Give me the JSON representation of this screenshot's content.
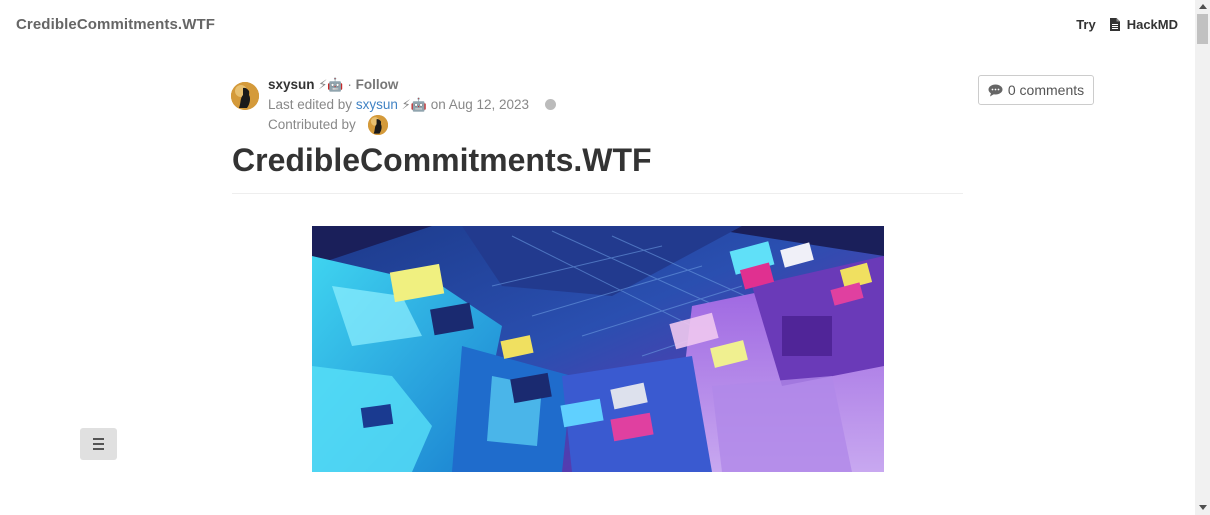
{
  "navbar": {
    "brand": "CredibleCommitments.WTF",
    "try_label": "Try",
    "hackmd_label": "HackMD"
  },
  "author": {
    "name": "sxysun",
    "badges": "⚡🤖",
    "separator": "·",
    "follow_label": "Follow"
  },
  "edit_info": {
    "prefix": "Last edited by",
    "editor": "sxysun",
    "badges": "⚡🤖",
    "date_text": "on Aug 12, 2023"
  },
  "contributed_label": "Contributed by",
  "comments_label": "0 comments",
  "page_title": "CredibleCommitments.WTF",
  "icons": {
    "doc": "file-text-icon",
    "comment": "comment-icon",
    "globe": "globe-icon",
    "toc": "menu-icon"
  },
  "colors": {
    "link": "#4183c4",
    "text": "#333333",
    "muted": "#888888"
  }
}
